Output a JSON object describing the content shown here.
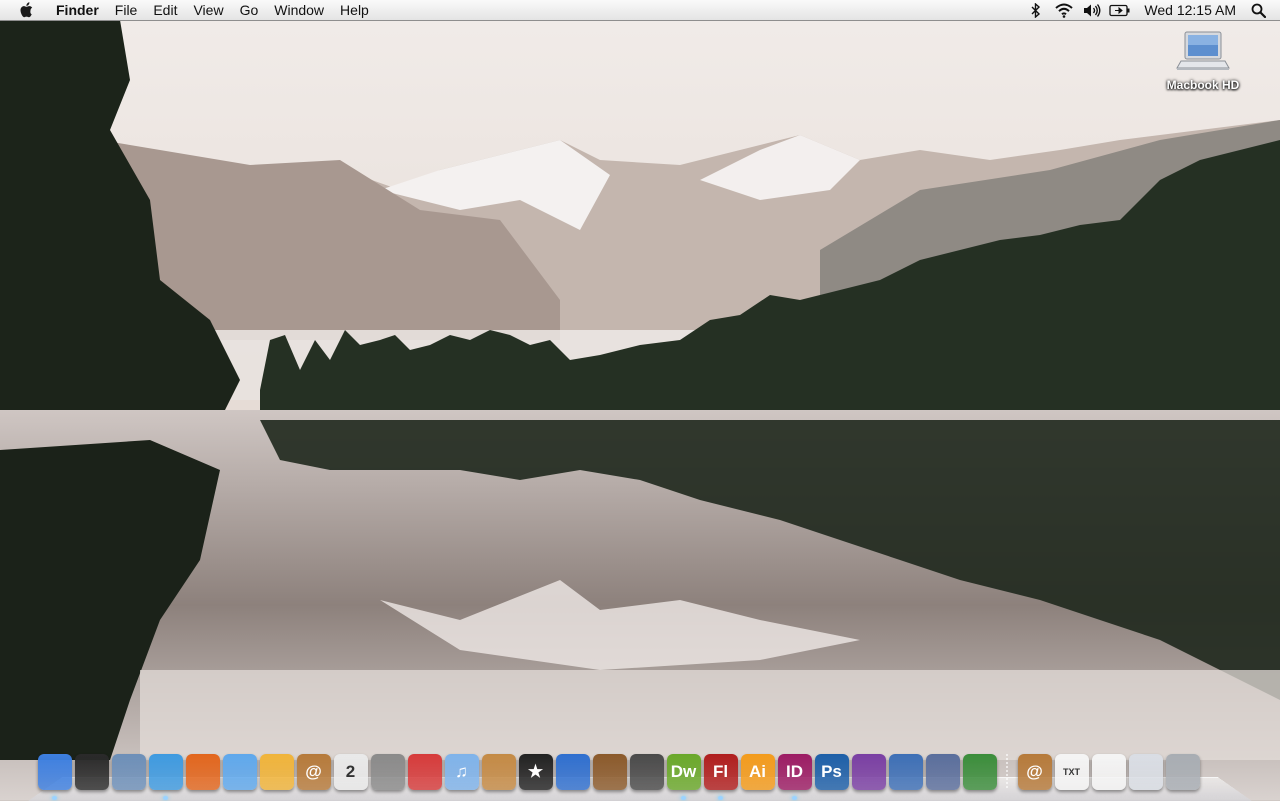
{
  "menubar": {
    "app_name": "Finder",
    "menus": [
      "File",
      "Edit",
      "View",
      "Go",
      "Window",
      "Help"
    ],
    "clock": "Wed 12:15 AM",
    "status_icons": [
      "bluetooth-icon",
      "wifi-icon",
      "volume-icon",
      "battery-icon"
    ]
  },
  "desktop": {
    "icons": [
      {
        "label": "Macbook HD",
        "icon": "hard-drive-icon"
      }
    ]
  },
  "dock": {
    "apps": [
      {
        "name": "finder-icon",
        "glyph": "",
        "color": "#3d7fe0"
      },
      {
        "name": "dashboard-icon",
        "glyph": "",
        "color": "#2a2a2a"
      },
      {
        "name": "mail-stamp-icon",
        "glyph": "",
        "color": "#6d8fb8"
      },
      {
        "name": "safari-icon",
        "glyph": "",
        "color": "#3e9ae0"
      },
      {
        "name": "firefox-icon",
        "glyph": "",
        "color": "#e2661d"
      },
      {
        "name": "ichat-icon",
        "glyph": "",
        "color": "#5fa8ec"
      },
      {
        "name": "transmit-icon",
        "glyph": "",
        "color": "#f0b43a"
      },
      {
        "name": "address-book-icon",
        "glyph": "@",
        "color": "#b67a3a"
      },
      {
        "name": "ical-icon",
        "glyph": "2",
        "color": "#e9e9e9"
      },
      {
        "name": "system-preferences-icon",
        "glyph": "",
        "color": "#8a8a8a"
      },
      {
        "name": "flashcard-icon",
        "glyph": "",
        "color": "#d63b3b"
      },
      {
        "name": "itunes-icon",
        "glyph": "♫",
        "color": "#7fb3ea"
      },
      {
        "name": "iphoto-icon",
        "glyph": "",
        "color": "#c48a45"
      },
      {
        "name": "imovie-icon",
        "glyph": "★",
        "color": "#222222"
      },
      {
        "name": "idvd-icon",
        "glyph": "",
        "color": "#2f6fcf"
      },
      {
        "name": "garageband-icon",
        "glyph": "",
        "color": "#8b5a2b"
      },
      {
        "name": "radio-icon",
        "glyph": "",
        "color": "#4a4a4a"
      },
      {
        "name": "dreamweaver-icon",
        "glyph": "Dw",
        "color": "#6aa82a"
      },
      {
        "name": "flash-icon",
        "glyph": "Fl",
        "color": "#b01e1e"
      },
      {
        "name": "illustrator-icon",
        "glyph": "Ai",
        "color": "#f39b1c"
      },
      {
        "name": "indesign-icon",
        "glyph": "ID",
        "color": "#9c1c64"
      },
      {
        "name": "photoshop-icon",
        "glyph": "Ps",
        "color": "#1d5fa8"
      },
      {
        "name": "aperture-icon",
        "glyph": "",
        "color": "#7a3fa3"
      },
      {
        "name": "keynote-icon",
        "glyph": "",
        "color": "#3d6fb6"
      },
      {
        "name": "script-editor-icon",
        "glyph": "",
        "color": "#5a6e9c"
      },
      {
        "name": "numbers-icon",
        "glyph": "",
        "color": "#3b8d3b"
      }
    ],
    "docs": [
      {
        "name": "address-book-folder-icon",
        "glyph": "@",
        "color": "#b67a3a"
      },
      {
        "name": "txt-document-icon",
        "glyph": "TXT",
        "color": "#f4f4f4"
      },
      {
        "name": "text-document-icon",
        "glyph": "",
        "color": "#f4f4f4"
      },
      {
        "name": "downloads-window-icon",
        "glyph": "",
        "color": "#d9dde4"
      },
      {
        "name": "trash-icon",
        "glyph": "",
        "color": "#a8adb3"
      }
    ]
  },
  "colors": {
    "menubar_bg": "#ededed",
    "running_indicator": "#9bd3ff"
  }
}
